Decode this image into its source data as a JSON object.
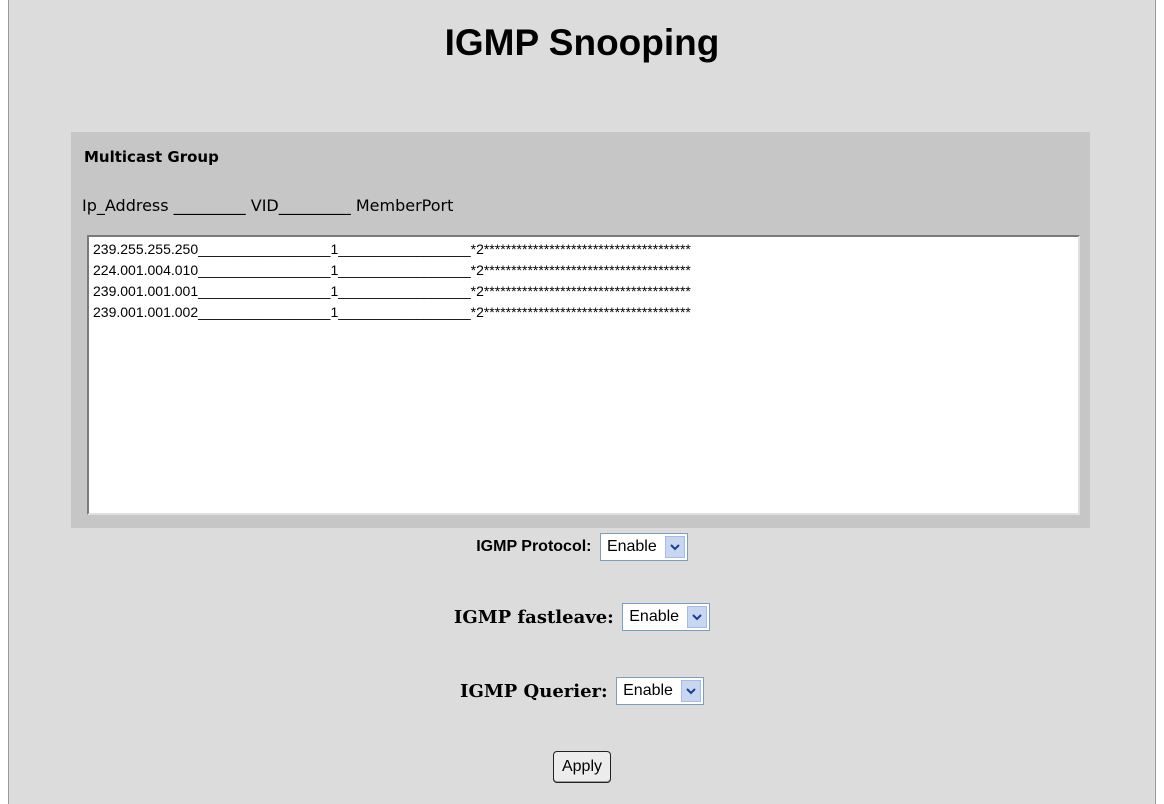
{
  "page_title": "IGMP Snooping",
  "multicast_group": {
    "heading": "Multicast Group",
    "columns_header": "Ip_Address _________ VID_________ MemberPort",
    "rows": [
      "239.255.255.250_________________1_________________*2**************************************",
      "224.001.004.010_________________1_________________*2**************************************",
      "239.001.001.001_________________1_________________*2**************************************",
      "239.001.001.002_________________1_________________*2**************************************"
    ]
  },
  "controls": {
    "protocol": {
      "label": "IGMP Protocol:",
      "value": "Enable"
    },
    "fastleave": {
      "label": "IGMP fastleave:",
      "value": "Enable"
    },
    "querier": {
      "label": "IGMP Querier:",
      "value": "Enable"
    }
  },
  "apply_label": "Apply",
  "colors": {
    "page_background": "#dcdcdc",
    "panel_background": "#c6c6c6",
    "select_arrow": "#c8d6f2"
  },
  "icons": {
    "select_arrow": "chevron-down-icon"
  }
}
